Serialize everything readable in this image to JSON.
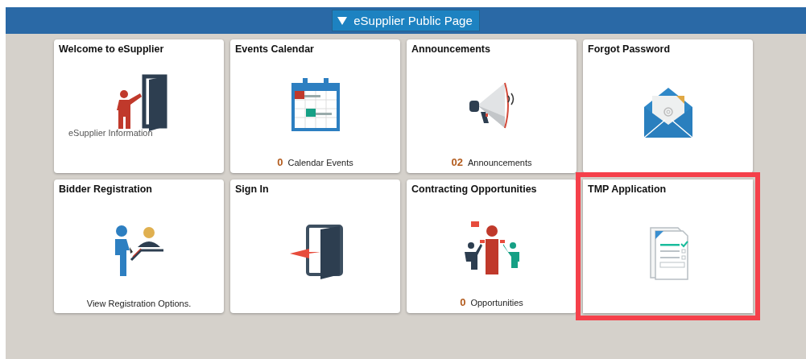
{
  "header": {
    "title": "eSupplier Public Page"
  },
  "tiles": [
    {
      "title": "Welcome to eSupplier",
      "kind": "presenter",
      "highlighted": false,
      "footer": {
        "kind": "caption",
        "label": "eSupplier Information"
      }
    },
    {
      "title": "Events Calendar",
      "kind": "calendar",
      "highlighted": false,
      "footer": {
        "kind": "count",
        "count": "0",
        "label": "Calendar Events"
      }
    },
    {
      "title": "Announcements",
      "kind": "megaphone",
      "highlighted": false,
      "footer": {
        "kind": "count",
        "count": "02",
        "label": "Announcements"
      }
    },
    {
      "title": "Forgot Password",
      "kind": "envelope",
      "highlighted": false
    },
    {
      "title": "Bidder Registration",
      "kind": "registration",
      "highlighted": false,
      "footer": {
        "kind": "note",
        "label": "View Registration Options."
      }
    },
    {
      "title": "Sign In",
      "kind": "signin",
      "highlighted": false
    },
    {
      "title": "Contracting Opportunities",
      "kind": "group",
      "highlighted": false,
      "footer": {
        "kind": "count",
        "count": "0",
        "label": "Opportunities"
      }
    },
    {
      "title": "TMP Application",
      "kind": "form",
      "highlighted": true
    }
  ]
}
